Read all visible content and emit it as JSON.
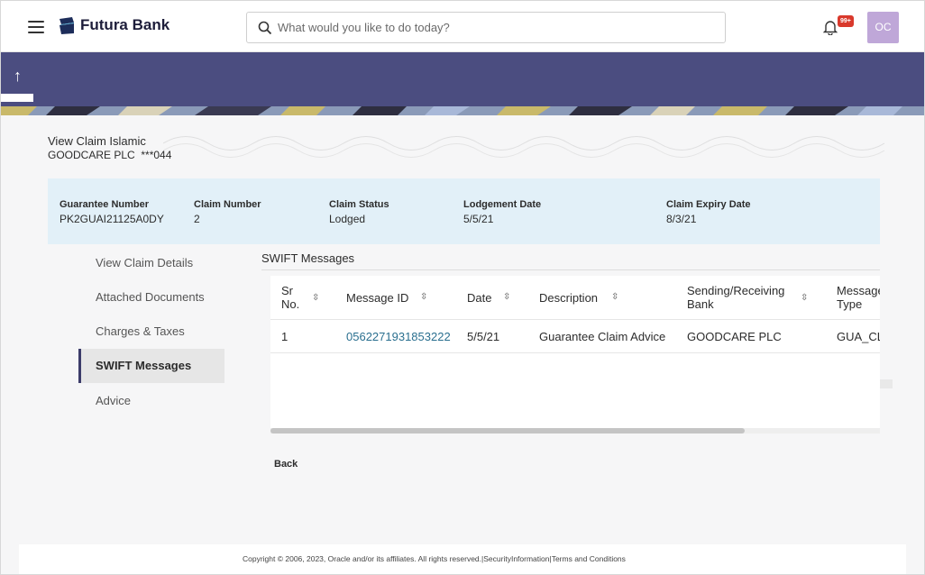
{
  "header": {
    "brand": "Futura Bank",
    "search_placeholder": "What would you like to do today?",
    "notification_badge": "99+",
    "avatar_initials": "OC"
  },
  "page": {
    "title": "View Claim Islamic",
    "subtitle": "GOODCARE PLC  ***044"
  },
  "summary": [
    {
      "label": "Guarantee Number",
      "value": "PK2GUAI21125A0DY"
    },
    {
      "label": "Claim Number",
      "value": "2"
    },
    {
      "label": "Claim Status",
      "value": "Lodged"
    },
    {
      "label": "Lodgement Date",
      "value": "5/5/21"
    },
    {
      "label": "Claim Expiry Date",
      "value": "8/3/21"
    }
  ],
  "side_menu": [
    {
      "label": "View Claim Details",
      "active": false
    },
    {
      "label": "Attached Documents",
      "active": false
    },
    {
      "label": "Charges & Taxes",
      "active": false
    },
    {
      "label": "SWIFT Messages",
      "active": true
    },
    {
      "label": "Advice",
      "active": false
    }
  ],
  "swift": {
    "section_title": "SWIFT Messages",
    "columns": [
      {
        "line1": "Sr",
        "line2": "No."
      },
      {
        "line1": "Message ID",
        "line2": ""
      },
      {
        "line1": "Date",
        "line2": ""
      },
      {
        "line1": "Description",
        "line2": ""
      },
      {
        "line1": "Sending/Receiving",
        "line2": "Bank"
      },
      {
        "line1": "Message",
        "line2": "Type"
      }
    ],
    "rows": [
      {
        "sr_no": "1",
        "message_id": "0562271931853222",
        "date": "5/5/21",
        "description": "Guarantee Claim Advice",
        "bank": "GOODCARE PLC",
        "message_type": "GUA_CLA"
      }
    ]
  },
  "actions": {
    "back": "Back"
  },
  "footer": {
    "copyright": "Copyright © 2006, 2023, Oracle and/or its affiliates. All rights reserved.",
    "separator": "|",
    "security": "SecurityInformation",
    "terms": "Terms and Conditions"
  },
  "colors": {
    "banner": "#4b4d80",
    "info_panel": "#e2f0f8",
    "link": "#2a6f8f",
    "avatar": "#bfa7d8",
    "badge": "#d9392c"
  }
}
